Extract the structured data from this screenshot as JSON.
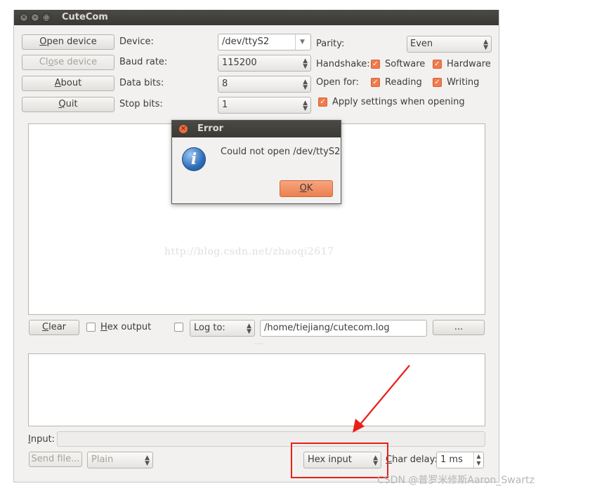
{
  "window": {
    "title": "CuteCom",
    "title_buttons": [
      "close-icon",
      "minimize-icon",
      "maximize-icon"
    ]
  },
  "buttons": {
    "open_device_pre": "O",
    "open_device_rest": "pen device",
    "close_device_pre": "Cl",
    "close_device_u": "o",
    "close_device_rest": "se device",
    "about_pre": "A",
    "about_rest": "bout",
    "quit_pre": "Q",
    "quit_rest": "uit",
    "clear_pre": "C",
    "clear_rest": "lear",
    "browse": "...",
    "send_file": "Send file..."
  },
  "settings": {
    "device_label": "Device:",
    "device_value": "/dev/ttyS2",
    "baud_label": "Baud rate:",
    "baud_value": "115200",
    "databits_label": "Data bits:",
    "databits_value": "8",
    "stopbits_label": "Stop bits:",
    "stopbits_value": "1",
    "parity_label": "Parity:",
    "parity_value": "Even",
    "handshake_label": "Handshake:",
    "handshake_software": "Software",
    "handshake_hardware": "Hardware",
    "openfor_label": "Open for:",
    "openfor_reading": "Reading",
    "openfor_writing": "Writing",
    "apply_settings": "Apply settings when opening"
  },
  "output": {
    "watermark": "http://blog.csdn.net/zhaoqi2617",
    "hex_output_pre": "H",
    "hex_output_rest": "ex output",
    "log_to": "Log to:",
    "log_path": "/home/tiejiang/cutecom.log"
  },
  "input_area": {
    "input_pre": "I",
    "input_rest": "nput:",
    "plain": "Plain",
    "hex_input": "Hex input",
    "char_delay_pre": "C",
    "char_delay_rest": "har delay:",
    "char_delay_value": "1 ms"
  },
  "dialog": {
    "title": "Error",
    "message": "Could not open /dev/ttyS2",
    "ok_pre": "O",
    "ok_rest": "K",
    "icon": "info-icon"
  },
  "colors": {
    "accent": "#ef7b4e",
    "annotation_red": "#e8201a",
    "titlebar": "#3c3b37"
  },
  "footer_watermark": "CSDN @普罗米修斯Aaron_Swartz"
}
